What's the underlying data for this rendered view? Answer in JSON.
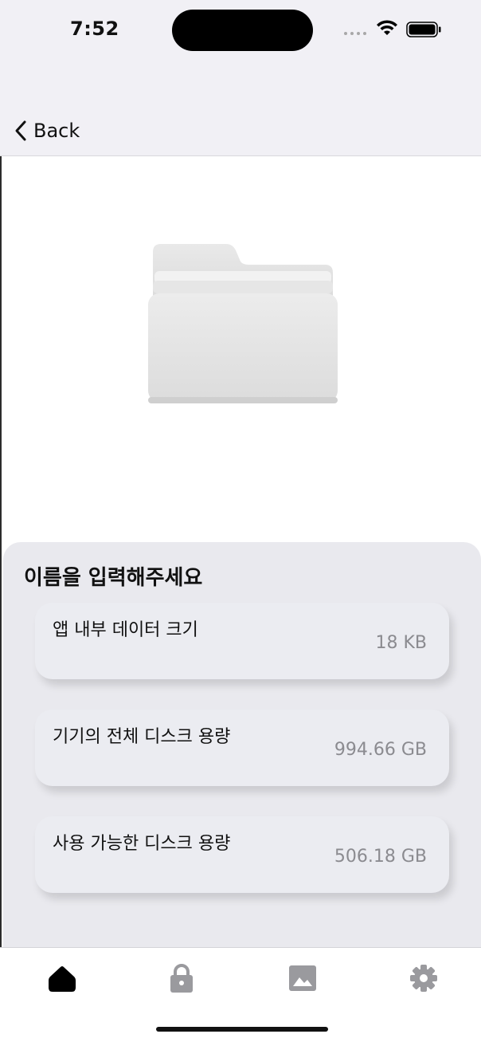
{
  "status_bar": {
    "time": "7:52"
  },
  "nav": {
    "back_label": "Back"
  },
  "card": {
    "title": "이름을 입력해주세요",
    "rows": [
      {
        "label": "앱 내부 데이터 크기",
        "value": "18 KB"
      },
      {
        "label": "기기의 전체 디스크 용량",
        "value": "994.66 GB"
      },
      {
        "label": "사용 가능한 디스크 용량",
        "value": "506.18 GB"
      }
    ]
  },
  "tabs": [
    {
      "icon": "home-icon",
      "active": true
    },
    {
      "icon": "lock-icon",
      "active": false
    },
    {
      "icon": "image-icon",
      "active": false
    },
    {
      "icon": "gear-icon",
      "active": false
    }
  ],
  "colors": {
    "bar_background": "#f1f0f5",
    "card_background": "#e9e9ee",
    "value_text": "#8b8b90",
    "tab_active": "#000000",
    "tab_inactive": "#9a9a9e"
  }
}
